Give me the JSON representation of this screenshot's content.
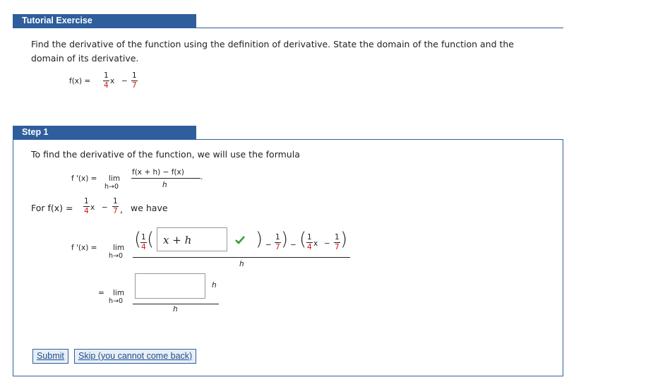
{
  "exercise": {
    "tab_label": "Tutorial Exercise",
    "prompt_line1": "Find the derivative of the function using the definition of derivative. State the domain of the function and the",
    "prompt_line2": "domain of its derivative.",
    "function_lhs": "f(x) =",
    "coef_num": "1",
    "coef_den": "4",
    "var": "x",
    "minus": "−",
    "const_num": "1",
    "const_den": "7"
  },
  "step": {
    "tab_label": "Step 1",
    "intro": "To find the derivative of the function, we will use the formula",
    "formula_lhs": "f '(x) =",
    "lim": "lim",
    "lim_sub": "h→0",
    "formula_num": "f(x + h) − f(x)",
    "formula_den": "h",
    "formula_period": ".",
    "for_text": "For  f(x) =",
    "we_have": "we have",
    "comma": ",",
    "line1_lhs": "f '(x)  =",
    "input1_value": "x + h",
    "input1_status": "correct",
    "den_h": "h",
    "line2_eq": "=",
    "input2_value": "",
    "h_label": "h"
  },
  "buttons": {
    "submit": "Submit",
    "skip": "Skip (you cannot come back)"
  },
  "colors": {
    "accent": "#2e5e9c",
    "red": "#d11111",
    "check": "#3a9a3a"
  }
}
